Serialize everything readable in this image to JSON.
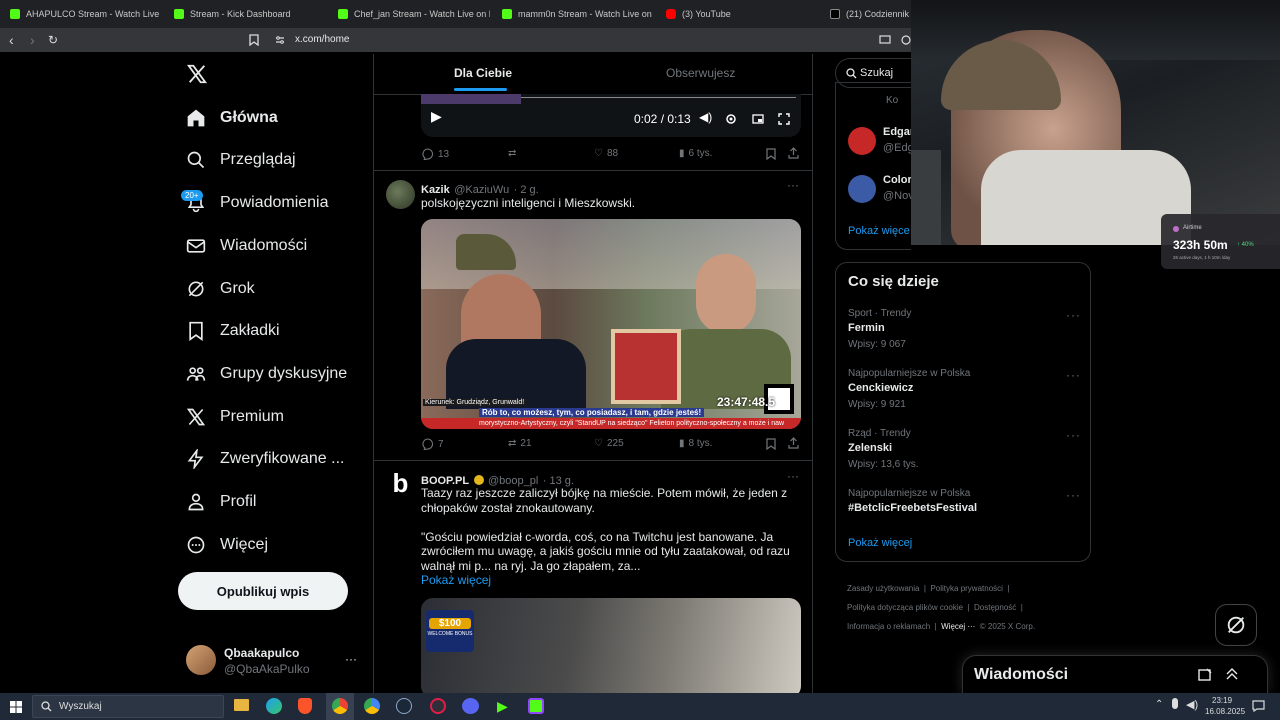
{
  "browser": {
    "tabs": [
      {
        "title": "AHAPULCO Stream - Watch Live on Kick",
        "icon": "kick-icon"
      },
      {
        "title": "Stream - Kick Dashboard",
        "icon": "kick-icon"
      },
      {
        "title": "Chef_jan Stream - Watch Live on Kick",
        "icon": "kick-icon"
      },
      {
        "title": "mamm0n Stream - Watch Live on Kick",
        "icon": "kick-icon"
      },
      {
        "title": "(3) YouTube",
        "icon": "youtube-icon"
      },
      {
        "title": "(21) Codziennik z",
        "icon": "x-icon"
      }
    ],
    "url": "x.com/home"
  },
  "nav": {
    "items": [
      {
        "label": "Główna",
        "icon": "home-icon"
      },
      {
        "label": "Przeglądaj",
        "icon": "search-icon"
      },
      {
        "label": "Powiadomienia",
        "icon": "bell-icon"
      },
      {
        "label": "Wiadomości",
        "icon": "mail-icon"
      },
      {
        "label": "Grok",
        "icon": "grok-icon"
      },
      {
        "label": "Zakładki",
        "icon": "bookmark-icon"
      },
      {
        "label": "Grupy dyskusyjne",
        "icon": "communities-icon"
      },
      {
        "label": "Premium",
        "icon": "x-icon"
      },
      {
        "label": "Zweryfikowane ...",
        "icon": "lightning-icon"
      },
      {
        "label": "Profil",
        "icon": "person-icon"
      },
      {
        "label": "Więcej",
        "icon": "more-circle-icon"
      }
    ],
    "notifications_badge": "20+",
    "publish_label": "Opublikuj wpis",
    "account": {
      "name": "Qbaakapulco",
      "handle": "@QbaAkaPulko"
    }
  },
  "feed": {
    "tabs": [
      "Dla Ciebie",
      "Obserwujesz"
    ],
    "video": {
      "time": "0:02 / 0:13"
    },
    "post0_actions": {
      "replies": "13",
      "likes": "88",
      "views": "6 tys."
    },
    "post1": {
      "name": "Kazik",
      "handle": "@KaziuWu",
      "time": "· 2 g.",
      "text": "polskojęzyczni inteligenci i Mieszkowski.",
      "image": {
        "clock": "23:47:48.5",
        "caption1": "Rób to, co możesz, tym, co posiadasz, i tam, gdzie jesteś!",
        "caption2": "Kierunek: Grudziądz, Grunwald!",
        "ticker": "morystyczno-Artystyczny, czyli \"StandUP na siedząco\" Felieton polityczno-społeczny a może i naw"
      },
      "actions": {
        "replies": "7",
        "reposts": "21",
        "likes": "225",
        "views": "8 tys."
      }
    },
    "post2": {
      "name": "BOOP.PL",
      "handle": "@boop_pl",
      "time": "· 13 g.",
      "text_lines": [
        "Taazy raz jeszcze zaliczył bójkę na mieście. Potem mówił, że jeden z",
        "chłopaków został znokautowany.",
        "",
        "\"Gościu powiedział c-worda, coś, co na Twitchu jest banowane. Ja",
        "zwróciłem mu uwagę, a jakiś gościu mnie od tyłu zaatakował, od razu",
        "walnął mi p... na ryj. Ja go złapałem, za..."
      ],
      "show_more": "Pokaż więcej",
      "image": {
        "promo": "$100",
        "promo_sub": "WELCOME BONUS"
      }
    }
  },
  "right": {
    "search_placeholder": "Szukaj",
    "follow_partial": [
      {
        "name": "Ko",
        "handle": ""
      },
      {
        "name": "Edgar",
        "handle": "@Edg"
      },
      {
        "name": "Color",
        "handle": "@Nov"
      }
    ],
    "follow_show_more": "Pokaż więce",
    "trends_title": "Co się dzieje",
    "trends": [
      {
        "meta": "Sport · Trendy",
        "name": "Fermin",
        "count": "Wpisy: 9 067"
      },
      {
        "meta": "Najpopularniejsze w Polska",
        "name": "Cenckiewicz",
        "count": "Wpisy: 9 921"
      },
      {
        "meta": "Rząd · Trendy",
        "name": "Zelenski",
        "count": "Wpisy: 13,6 tys."
      },
      {
        "meta": "Najpopularniejsze w Polska",
        "name": "#BetclicFreebetsFestival",
        "count": ""
      }
    ],
    "trends_show_more": "Pokaż więcej",
    "footer": {
      "links": [
        "Zasady użytkowania",
        "Polityka prywatności",
        "Polityka dotycząca plików cookie",
        "Dostępność",
        "Informacja o reklamach",
        "Więcej ···"
      ],
      "copyright": "© 2025 X Corp."
    }
  },
  "messages_drawer": {
    "title": "Wiadomości"
  },
  "airtime": {
    "label": "Airtime",
    "hours": "323h 50m",
    "delta": "↑ 40%",
    "sub": "26 active days, 1 h 10m /day"
  },
  "taskbar": {
    "search_label": "Wyszukaj",
    "time": "23:19",
    "date": "16.08.2025"
  },
  "colors": {
    "accent": "#1d9bf0",
    "kick": "#53fc18",
    "background": "#000000",
    "border": "#2f3336"
  }
}
